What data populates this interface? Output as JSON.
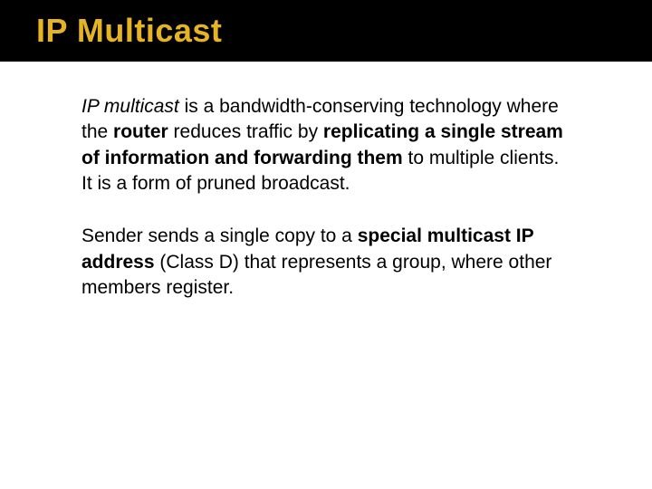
{
  "title": "IP Multicast",
  "p1": {
    "s1_italic": "IP multicast",
    "s2": " is a bandwidth-conserving technology where the ",
    "s3_bold": "router",
    "s4": " reduces traffic by ",
    "s5_bold": "replicating a single stream of information and forwarding them",
    "s6": " to multiple clients. It is a form of pruned broadcast."
  },
  "p2": {
    "s1": "Sender sends a single copy to a ",
    "s2_bold": "special multicast IP address",
    "s3": " (Class D) that represents a group, where other members register."
  }
}
